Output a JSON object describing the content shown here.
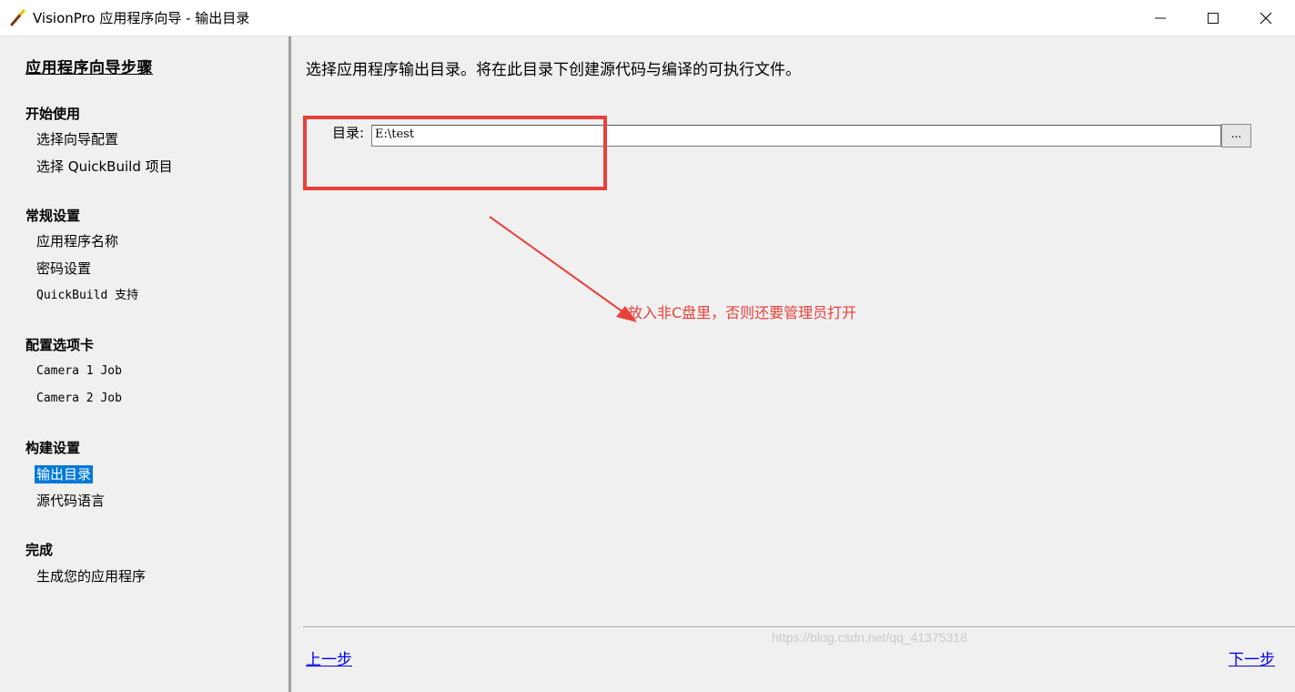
{
  "window": {
    "title": "VisionPro 应用程序向导 - 输出目录",
    "app_icon": "wand-icon",
    "controls": [
      "minimize-icon",
      "maximize-icon",
      "close-icon"
    ]
  },
  "sidebar": {
    "heading": "应用程序向导步骤",
    "sections": [
      {
        "title": "开始使用",
        "items": [
          "选择向导配置",
          "选择 QuickBuild 项目"
        ]
      },
      {
        "title": "常规设置",
        "items": [
          "应用程序名称",
          "密码设置",
          "QuickBuild 支持"
        ]
      },
      {
        "title": "配置选项卡",
        "items": [
          "Camera 1 Job",
          "Camera 2 Job"
        ]
      },
      {
        "title": "构建设置",
        "items": [
          "输出目录",
          "源代码语言"
        ]
      },
      {
        "title": "完成",
        "items": [
          "生成您的应用程序"
        ]
      }
    ],
    "active_item": "输出目录"
  },
  "main": {
    "instruction": "选择应用程序输出目录。将在此目录下创建源代码与编译的可执行文件。",
    "directory_label": "目录:",
    "directory_value": "E:\\test",
    "browse_label": "...",
    "annotation": "放入非C盘里，否则还要管理员打开",
    "prev_label": "上一步",
    "next_label": "下一步",
    "watermark": "https://blog.csdn.net/qq_41375318"
  },
  "colors": {
    "accent": "#0078d7",
    "annotation": "#e8403b",
    "link": "#0000ee"
  }
}
